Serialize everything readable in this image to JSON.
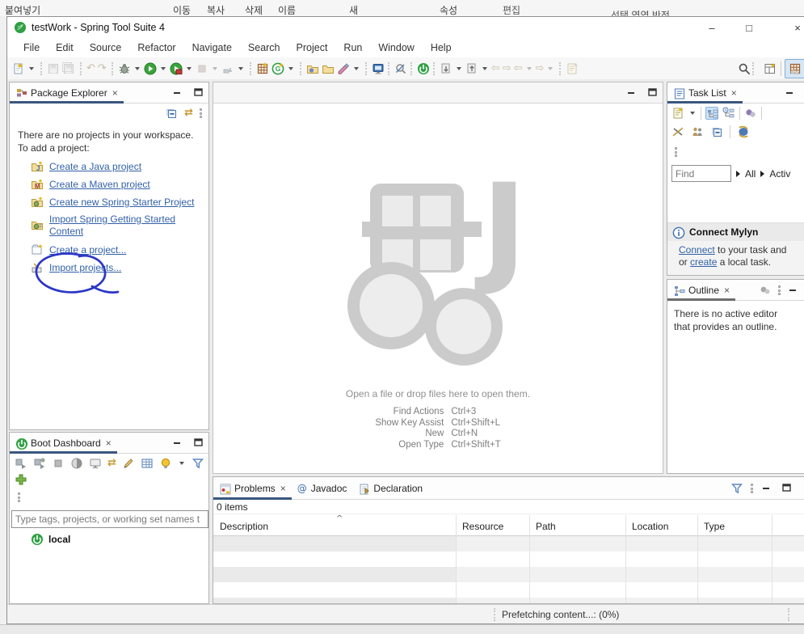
{
  "bg_ribbon": {
    "paste": "붙여넣기",
    "move": "이동",
    "copy": "복사",
    "delete": "삭제",
    "rename": "이름",
    "new": "새",
    "properties": "속성",
    "edit": "편집",
    "invert_selection": "선택 영역 반전"
  },
  "window": {
    "title": "testWork - Spring Tool Suite 4"
  },
  "icons": {
    "minimize": "–",
    "maximize": "□",
    "close": "×",
    "tab_close": "×",
    "undo": "↶",
    "redo": "↷",
    "back": "⇦",
    "forward": "⇨",
    "link_editor": "⇄",
    "sync": "⟳",
    "javadoc_at": "@",
    "sort_asc": "^"
  },
  "menu": {
    "items": [
      "File",
      "Edit",
      "Source",
      "Refactor",
      "Navigate",
      "Search",
      "Project",
      "Run",
      "Window",
      "Help"
    ]
  },
  "package_explorer": {
    "tab": "Package Explorer",
    "empty_text_1": "There are no projects in your workspace.",
    "empty_text_2": "To add a project:",
    "links": {
      "java": "Create a Java project",
      "maven": "Create a Maven project",
      "spring_starter": "Create new Spring Starter Project",
      "spring_content_1": "Import Spring Getting Started",
      "spring_content_2": "Content",
      "create_project": "Create a project...",
      "import_projects": "Import projects..."
    }
  },
  "editor": {
    "drop_hint": "Open a file or drop files here to open them.",
    "shortcuts": [
      {
        "action": "Find Actions",
        "keys": "Ctrl+3"
      },
      {
        "action": "Show Key Assist",
        "keys": "Ctrl+Shift+L"
      },
      {
        "action": "New",
        "keys": "Ctrl+N"
      },
      {
        "action": "Open Type",
        "keys": "Ctrl+Shift+T"
      }
    ]
  },
  "task_list": {
    "tab": "Task List",
    "find_placeholder": "Find",
    "scope_all": "All",
    "scope_active": "Activ"
  },
  "mylyn": {
    "title": "Connect Mylyn",
    "link_connect": "Connect",
    "text_after_connect": " to your task and",
    "text_or": "or ",
    "link_create": "create",
    "text_after_create": " a local task."
  },
  "outline": {
    "tab": "Outline",
    "empty_text": "There is no active editor that provides an outline."
  },
  "boot_dashboard": {
    "tab": "Boot Dashboard",
    "filter_placeholder": "Type tags, projects, or working set names t",
    "local_item": "local"
  },
  "problems": {
    "tab_problems": "Problems",
    "tab_javadoc": "Javadoc",
    "tab_declaration": "Declaration",
    "items_count": "0 items",
    "columns": [
      "Description",
      "Resource",
      "Path",
      "Location",
      "Type"
    ]
  },
  "status": {
    "message": "Prefetching content...: (0%)"
  }
}
